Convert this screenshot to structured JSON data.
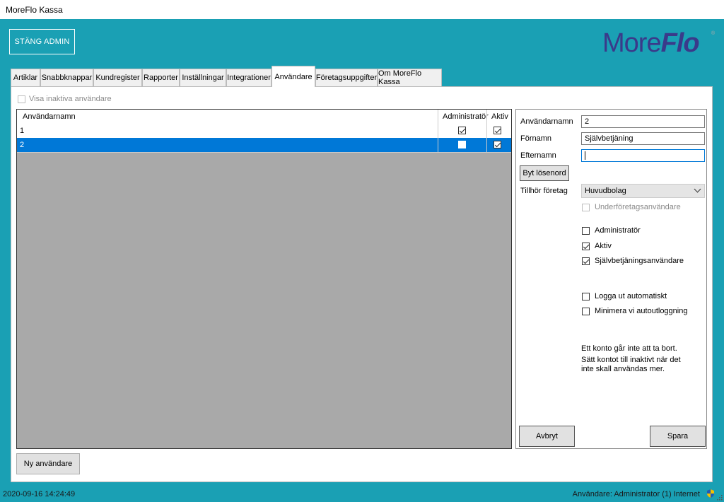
{
  "window": {
    "title": "MoreFlo Kassa"
  },
  "header": {
    "close_admin": "STÄNG ADMIN",
    "logo_more": "More",
    "logo_flo": "Flo",
    "logo_reg": "®"
  },
  "tabs": [
    "Artiklar",
    "Snabbknappar",
    "Kundregister",
    "Rapporter",
    "Inställningar",
    "Integrationer",
    "Användare",
    "Företagsuppgifter",
    "Om MoreFlo Kassa"
  ],
  "active_tab": "Användare",
  "show_inactive": {
    "label": "Visa inaktiva användare",
    "checked": false,
    "enabled": false
  },
  "grid": {
    "columns": [
      "Användarnamn",
      "Administratör",
      "Aktiv"
    ],
    "rows": [
      {
        "username": "1",
        "admin": true,
        "active": true,
        "selected": false
      },
      {
        "username": "2",
        "admin": false,
        "active": true,
        "selected": true
      }
    ]
  },
  "detail": {
    "username_label": "Användarnamn",
    "username_value": "2",
    "firstname_label": "Förnamn",
    "firstname_value": "Självbetjäning",
    "lastname_label": "Efternamn",
    "lastname_value": "",
    "change_password": "Byt lösenord",
    "company_label": "Tillhör företag",
    "company_value": "Huvudbolag",
    "sub_company_user": "Underföretagsanvändare",
    "admin_label": "Administratör",
    "active_label": "Aktiv",
    "selfservice_label": "Självbetjäningsanvändare",
    "auto_logout_label": "Logga ut automatiskt",
    "minimize_label": "Minimera vi autoutloggning",
    "note_line1": "Ett konto går inte att ta bort.",
    "note_line2": "Sätt kontot till inaktivt när det",
    "note_line3": "inte skall användas mer.",
    "cancel": "Avbryt",
    "save": "Spara"
  },
  "new_user": "Ny användare",
  "status": {
    "datetime": "2020-09-16 14:24:49",
    "user": "Användare: Administrator  (1)  Internet"
  },
  "colors": {
    "accent": "#1aa0b4",
    "selection": "#0078d7",
    "logo": "#3a3a8a"
  }
}
